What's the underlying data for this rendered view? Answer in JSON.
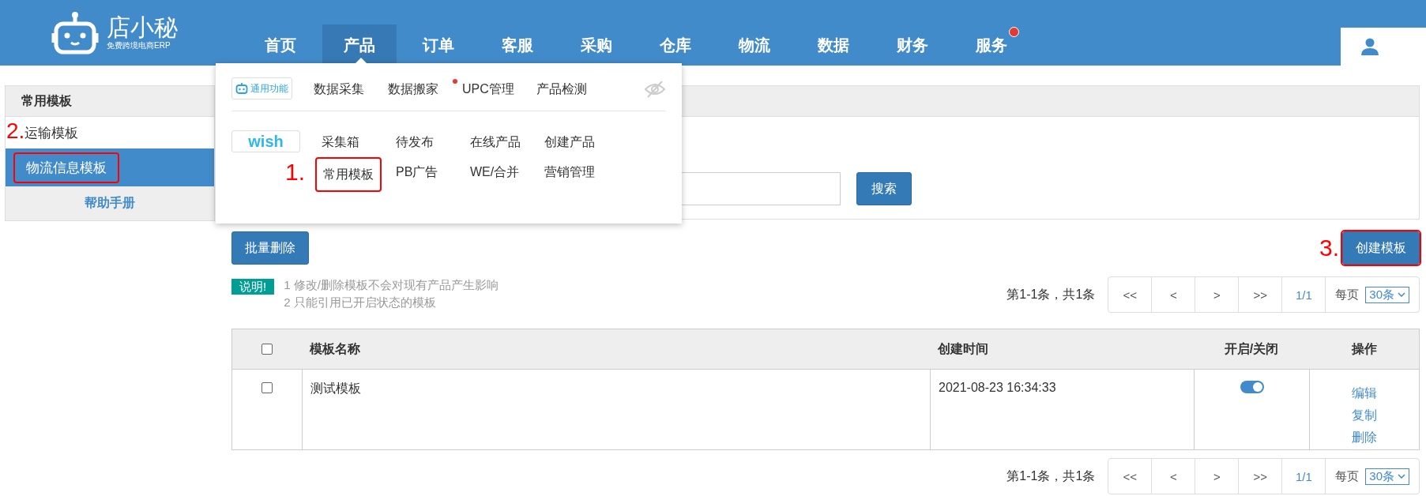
{
  "header": {
    "logo": {
      "name": "店小秘",
      "tagline": "免费跨境电商ERP"
    },
    "nav": [
      {
        "label": "首页",
        "selected": false,
        "dot": false
      },
      {
        "label": "产品",
        "selected": true,
        "dot": false
      },
      {
        "label": "订单",
        "selected": false,
        "dot": false
      },
      {
        "label": "客服",
        "selected": false,
        "dot": false
      },
      {
        "label": "采购",
        "selected": false,
        "dot": false
      },
      {
        "label": "仓库",
        "selected": false,
        "dot": false
      },
      {
        "label": "物流",
        "selected": false,
        "dot": false
      },
      {
        "label": "数据",
        "selected": false,
        "dot": false
      },
      {
        "label": "财务",
        "selected": false,
        "dot": false
      },
      {
        "label": "服务",
        "selected": false,
        "dot": true
      }
    ]
  },
  "dropdown": {
    "groups": [
      {
        "kind": "general",
        "badge": "通用功能",
        "items": [
          {
            "label": "数据采集",
            "dot": false
          },
          {
            "label": "数据搬家",
            "dot": true
          },
          {
            "label": "UPC管理",
            "dot": false
          },
          {
            "label": "产品检测",
            "dot": false
          }
        ]
      },
      {
        "kind": "wish",
        "badge": "wish",
        "items": [
          {
            "label": "采集箱",
            "dot": false
          },
          {
            "label": "待发布",
            "dot": false
          },
          {
            "label": "在线产品",
            "dot": false
          },
          {
            "label": "创建产品",
            "dot": false
          },
          {
            "label": "常用模板",
            "dot": false,
            "annotation": "1."
          },
          {
            "label": "PB广告",
            "dot": false
          },
          {
            "label": "WE/合并",
            "dot": false
          },
          {
            "label": "营销管理",
            "dot": false
          }
        ]
      }
    ]
  },
  "sidebar": {
    "title": "常用模板",
    "items": [
      {
        "label": "运输模板",
        "selected": false
      },
      {
        "label": "物流信息模板",
        "selected": true,
        "annotation": "2."
      }
    ],
    "help_link": "帮助手册"
  },
  "search": {
    "button": "搜索"
  },
  "toolbar": {
    "bulk_delete": "批量删除",
    "create": {
      "label": "创建模板",
      "annotation": "3."
    }
  },
  "notes": {
    "tag": "说明!",
    "lines": [
      "1 修改/删除模板不会对现有产品产生影响",
      "2 只能引用已开启状态的模板"
    ]
  },
  "pagination_top": {
    "summary": "第1-1条，共1条",
    "buttons": [
      "<<",
      "<",
      ">",
      ">>"
    ],
    "page": "1/1",
    "per_page_label": "每页",
    "per_page": "30条"
  },
  "table": {
    "header_checked": false,
    "columns": [
      "模板名称",
      "创建时间",
      "开启/关闭",
      "操作"
    ],
    "rows": [
      {
        "checked": false,
        "name": "测试模板",
        "created": "2021-08-23 16:34:33",
        "on": true,
        "actions": [
          "编辑",
          "复制",
          "删除"
        ]
      }
    ]
  },
  "pagination_bottom": {
    "summary": "第1-1条，共1条",
    "buttons": [
      "<<",
      "<",
      ">",
      ">>"
    ],
    "page": "1/1",
    "per_page_label": "每页",
    "per_page": "30条"
  }
}
